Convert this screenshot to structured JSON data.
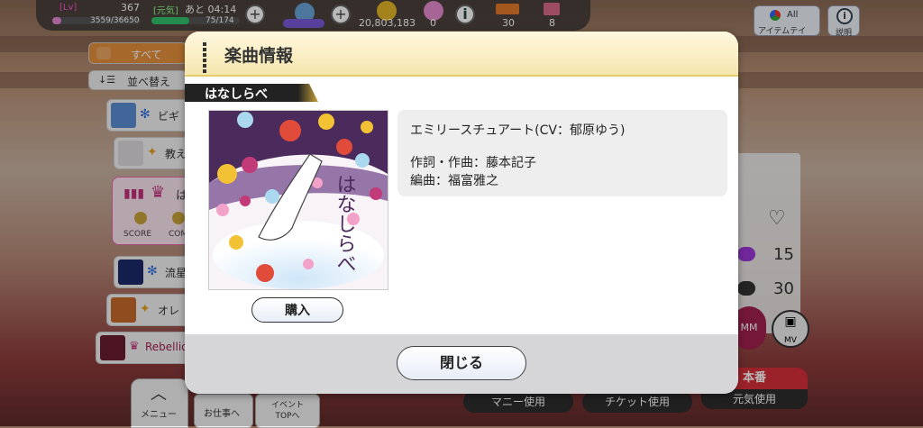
{
  "status": {
    "lv_label": "[Lv]",
    "lv_value": "367",
    "exp": "3559/36650",
    "exp_fraction": 0.097,
    "genki_label": "[元気]",
    "genki_timer": "あと 04:14",
    "genki_value": "75/174",
    "genki_fraction": 0.43,
    "money": "20,803,183",
    "item_a": "0",
    "ticket": "30",
    "item_b": "8"
  },
  "top_right": {
    "all_label": "All",
    "item_label": "アイテムテイ",
    "help_label": "説明"
  },
  "left_panel": {
    "all_tab": "すべて",
    "sort_label": "並べ替え",
    "songs": [
      {
        "label": "ビギ"
      },
      {
        "label": "教え"
      },
      {
        "label": "は"
      },
      {
        "label": "流星"
      },
      {
        "label": "オレ"
      },
      {
        "label": "Rebellio"
      }
    ],
    "score_label": "SCORE",
    "com_label": "COM"
  },
  "right_panel": {
    "num1": "15",
    "num2": "30",
    "mv_label": "MV",
    "mm_label": "MM"
  },
  "bottom": {
    "menu_label": "メニュー",
    "job_label": "お仕事へ",
    "event_label": "イベント TOPへ",
    "money_use": "マニー使用",
    "ticket_use": "チケット使用",
    "honban": "本番",
    "genki_use": "元気使用"
  },
  "modal": {
    "title": "楽曲情報",
    "song_title": "はなしらべ",
    "artist_line": "エミリースチュアート(CV：郁原ゆう)",
    "lyrics_composer": "作詞・作曲：藤本記子",
    "arranger": "編曲：福富雅之",
    "buy_label": "購入",
    "close_label": "閉じる",
    "jacket_calligraphy": "はなしらべ"
  },
  "colors": {
    "modal_header": "#f5e6ad",
    "modal_footer": "#d6d6d8",
    "info_box": "#eeeeef",
    "accent_gold": "#c9a43a",
    "honban_red": "#d9303a"
  }
}
